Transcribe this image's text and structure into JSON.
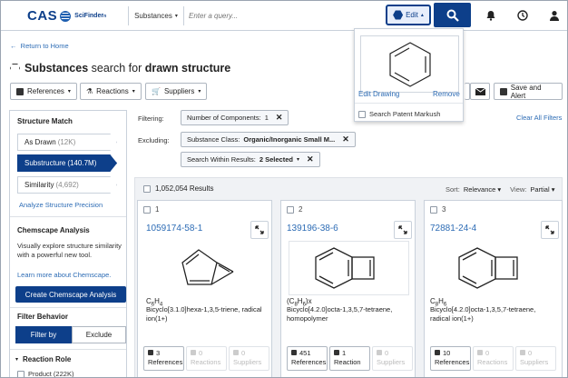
{
  "header": {
    "logo_cas": "CAS",
    "logo_product": "SciFinder",
    "search_type": "Substances",
    "search_placeholder": "Enter a query...",
    "edit_label": "Edit"
  },
  "edit_dropdown": {
    "edit_drawing": "Edit Drawing",
    "remove": "Remove",
    "search_patent_markush": "Search Patent Markush"
  },
  "page": {
    "return_link": "Return to Home",
    "title_bold": "Substances",
    "title_rest": "search for",
    "title_end": "drawn structure"
  },
  "toolbar": {
    "references": "References",
    "reactions": "Reactions",
    "suppliers": "Suppliers",
    "save_alert": "Save and Alert"
  },
  "sidebar": {
    "structure_match_heading": "Structure Match",
    "items": [
      {
        "label": "As Drawn",
        "count": "(12K)"
      },
      {
        "label": "Substructure",
        "count": "(140.7M)"
      },
      {
        "label": "Similarity",
        "count": "(4,692)"
      }
    ],
    "analyze_link": "Analyze Structure Precision",
    "chemscape_heading": "Chemscape Analysis",
    "chemscape_text": "Visually explore structure similarity with a powerful new tool.",
    "chemscape_link": "Learn more about Chemscape.",
    "chemscape_button": "Create Chemscape Analysis",
    "filter_behavior_heading": "Filter Behavior",
    "filter_by": "Filter by",
    "exclude": "Exclude",
    "reaction_role_heading": "Reaction Role",
    "product_label": "Product (222K)"
  },
  "filters": {
    "filtering_label": "Filtering:",
    "excluding_label": "Excluding:",
    "number_of_components_label": "Number of Components:",
    "number_of_components_value": "1",
    "substance_class_label": "Substance Class:",
    "substance_class_value": "Organic/Inorganic Small M...",
    "search_within_label": "Search Within Results:",
    "search_within_value": "2 Selected",
    "clear_all": "Clear All Filters"
  },
  "results": {
    "count": "1,052,054 Results",
    "sort_label": "Sort:",
    "sort_value": "Relevance",
    "view_label": "View:",
    "view_value": "Partial",
    "cards": [
      {
        "num": "1",
        "cas": "1059174-58-1",
        "formula_main": "C",
        "formula_a": "6",
        "formula_b": "H",
        "formula_c": "4",
        "name": "Bicyclo[3.1.0]hexa-1,3,5-triene, radical ion(1+)",
        "refs_count": "3",
        "refs_label": "References",
        "rxn_count": "0",
        "rxn_label": "Reactions",
        "sup_count": "0",
        "sup_label": "Suppliers"
      },
      {
        "num": "2",
        "cas": "139196-38-6",
        "formula_main": "(C",
        "formula_a": "8",
        "formula_b": "H",
        "formula_c": "6",
        "formula_suffix": ")x",
        "name": "Bicyclo[4.2.0]octa-1,3,5,7-tetraene, homopolymer",
        "refs_count": "451",
        "refs_label": "References",
        "rxn_count": "1",
        "rxn_label": "Reaction",
        "sup_count": "0",
        "sup_label": "Suppliers"
      },
      {
        "num": "3",
        "cas": "72881-24-4",
        "formula_main": "C",
        "formula_a": "8",
        "formula_b": "H",
        "formula_c": "6",
        "name": "Bicyclo[4.2.0]octa-1,3,5,7-tetraene, radical ion(1+)",
        "refs_count": "10",
        "refs_label": "References",
        "rxn_count": "0",
        "rxn_label": "Reactions",
        "sup_count": "0",
        "sup_label": "Suppliers"
      }
    ]
  },
  "colors": {
    "brand": "#0d3f8a",
    "link": "#2d6cb5"
  }
}
